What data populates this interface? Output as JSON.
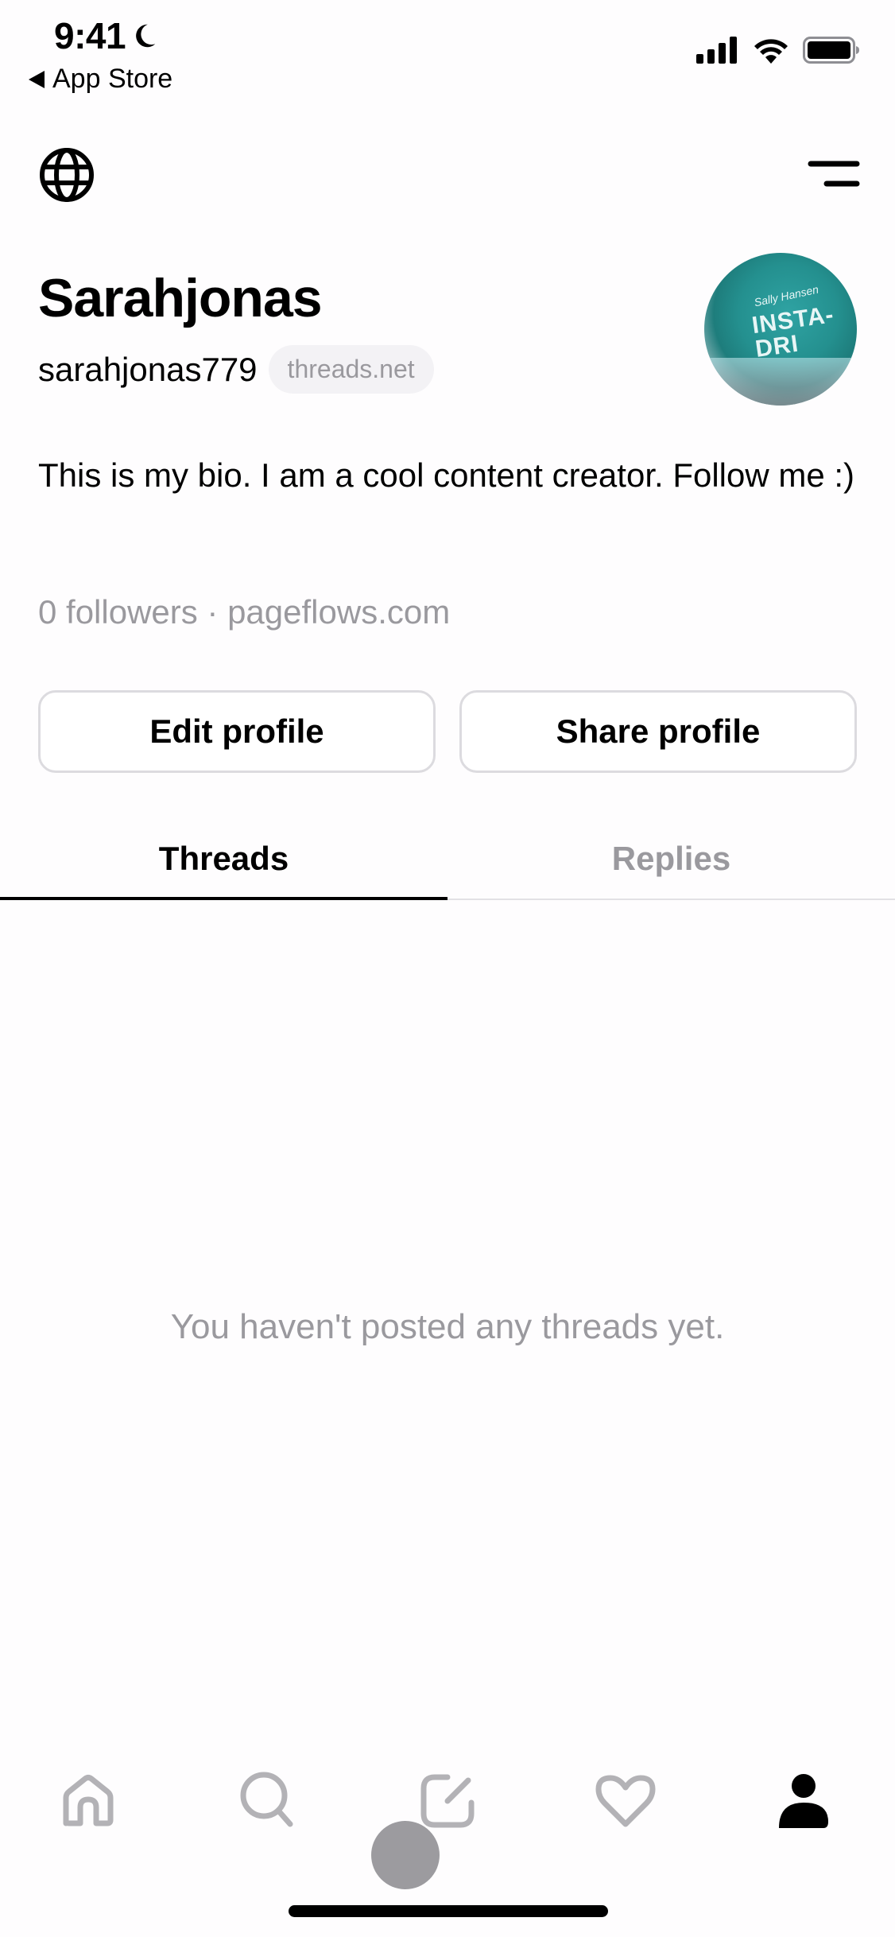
{
  "status_bar": {
    "time": "9:41",
    "back_app_label": "App Store",
    "icons": [
      "moon-icon",
      "cellular-signal-icon",
      "wifi-icon",
      "battery-icon"
    ]
  },
  "header": {
    "left_icon": "globe-icon",
    "right_icon": "menu-icon"
  },
  "profile": {
    "display_name": "Sarahjonas",
    "username": "sarahjonas779",
    "domain_badge": "threads.net",
    "avatar_text": {
      "brand": "Sally Hansen",
      "label_line1": "INSTA-",
      "label_line2": "DRI"
    },
    "bio": "This is my bio. I am a cool content creator. Follow me :)",
    "meta": "0 followers · pageflows.com"
  },
  "actions": {
    "edit_label": "Edit profile",
    "share_label": "Share profile"
  },
  "tabs": [
    {
      "label": "Threads",
      "active": true
    },
    {
      "label": "Replies",
      "active": false
    }
  ],
  "empty_state": "You haven't posted any threads yet.",
  "bottom_nav": [
    {
      "name": "home",
      "icon": "home-icon",
      "active": false
    },
    {
      "name": "search",
      "icon": "search-icon",
      "active": false
    },
    {
      "name": "compose",
      "icon": "compose-icon",
      "active": false
    },
    {
      "name": "activity",
      "icon": "heart-icon",
      "active": false
    },
    {
      "name": "profile",
      "icon": "person-icon",
      "active": true
    }
  ],
  "colors": {
    "text_primary": "#000000",
    "text_secondary": "#9a999e",
    "icon_inactive": "#b3b2b6",
    "border": "#dcdbdf",
    "pill_bg": "#f3f2f5"
  }
}
